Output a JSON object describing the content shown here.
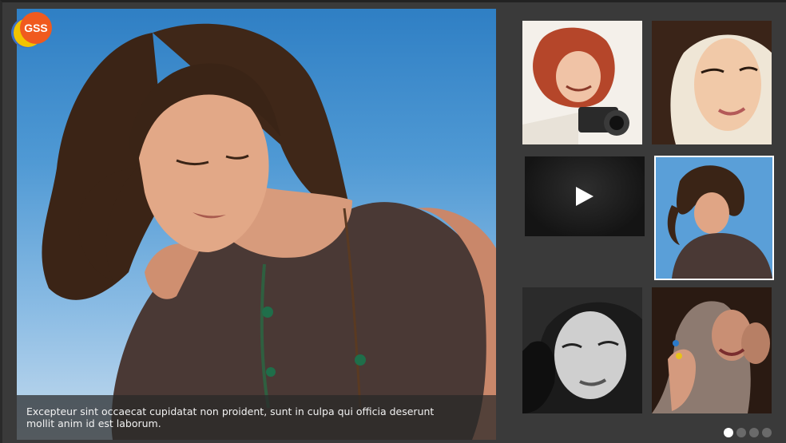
{
  "logo": {
    "text": "GSS"
  },
  "slide": {
    "caption_line1": "Excepteur sint occaecat cupidatat non proident, sunt in culpa qui officia deserunt",
    "caption_line2": "mollit anim id est laborum."
  },
  "thumbnails": [
    {
      "name": "photographer-woman",
      "kind": "photo"
    },
    {
      "name": "smiling-woman-portrait",
      "kind": "photo"
    },
    {
      "name": "video",
      "kind": "video",
      "icon": "play-icon"
    },
    {
      "name": "woman-blue-sky",
      "kind": "photo",
      "selected": true
    },
    {
      "name": "bw-portrait",
      "kind": "photo"
    },
    {
      "name": "laughing-women",
      "kind": "photo"
    }
  ],
  "pager": {
    "count": 4,
    "active_index": 0
  },
  "colors": {
    "background": "#3a3a3a",
    "caption_bg": "#282828",
    "active_border": "#ffffff",
    "dot_on": "#ffffff",
    "dot_off": "#6a6a6a",
    "logo_accent": "#f05a1e"
  }
}
